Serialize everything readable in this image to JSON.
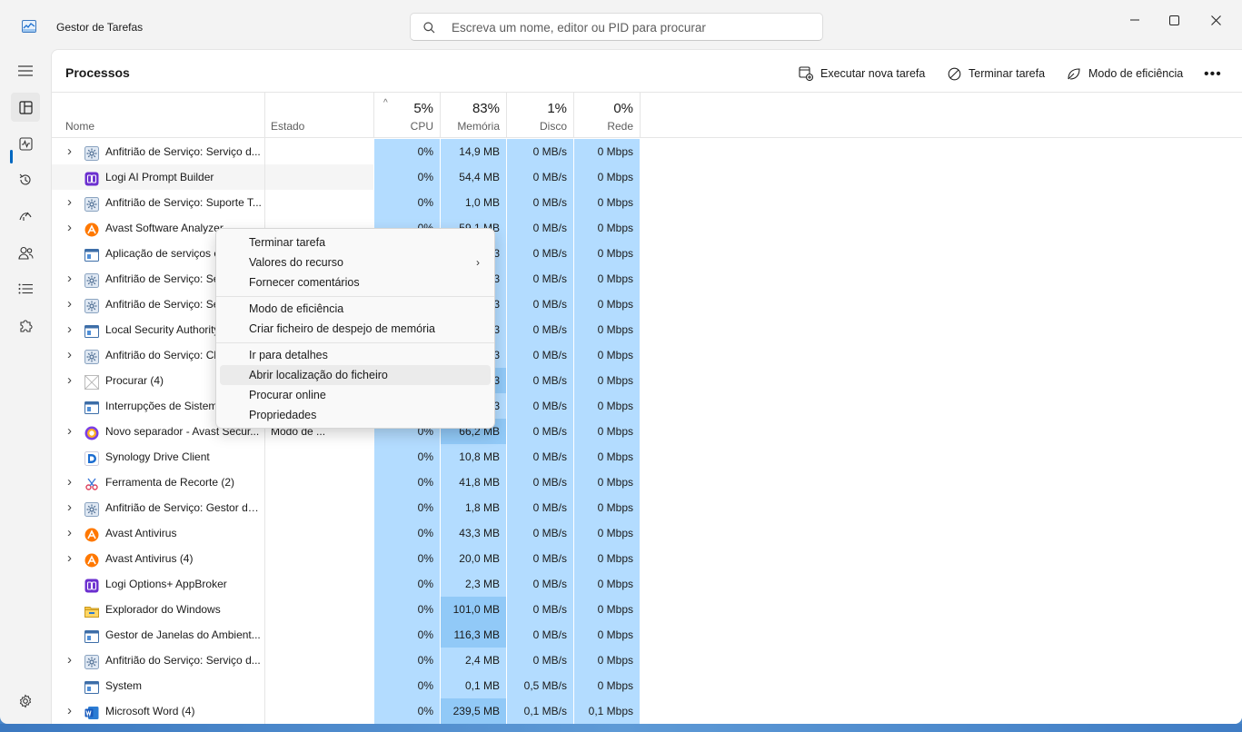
{
  "window": {
    "title": "Gestor de Tarefas"
  },
  "search": {
    "placeholder": "Escreva um nome, editor ou PID para procurar"
  },
  "header": {
    "title": "Processos",
    "run_task": "Executar nova tarefa",
    "end_task": "Terminar tarefa",
    "efficiency": "Modo de eficiência",
    "more": "•••"
  },
  "columns": {
    "name": "Nome",
    "status": "Estado",
    "cpu": {
      "pct": "5%",
      "label": "CPU"
    },
    "memory": {
      "pct": "83%",
      "label": "Memória"
    },
    "disk": {
      "pct": "1%",
      "label": "Disco"
    },
    "network": {
      "pct": "0%",
      "label": "Rede"
    }
  },
  "processes": [
    {
      "expand": true,
      "icon": "gear-icon",
      "name": "Anfitrião de Serviço: Serviço d...",
      "status": "",
      "cpu": "0%",
      "mem": "14,9 MB",
      "disk": "0 MB/s",
      "net": "0 Mbps"
    },
    {
      "expand": false,
      "icon": "logi-icon",
      "name": "Logi AI Prompt Builder",
      "status": "",
      "cpu": "0%",
      "mem": "54,4 MB",
      "disk": "0 MB/s",
      "net": "0 Mbps"
    },
    {
      "expand": true,
      "icon": "gear-icon",
      "name": "Anfitrião de Serviço: Suporte T...",
      "status": "",
      "cpu": "0%",
      "mem": "1,0 MB",
      "disk": "0 MB/s",
      "net": "0 Mbps"
    },
    {
      "expand": true,
      "icon": "avast-icon",
      "name": "Avast Software Analyzer",
      "status": "",
      "cpu": "0%",
      "mem": "59,1 MB",
      "disk": "0 MB/s",
      "net": "0 Mbps"
    },
    {
      "expand": false,
      "icon": "window-icon",
      "name": "Aplicação de serviços e",
      "status": "",
      "cpu": "0%",
      "mem": "3",
      "disk": "0 MB/s",
      "net": "0 Mbps"
    },
    {
      "expand": true,
      "icon": "gear-icon",
      "name": "Anfitrião de Serviço: Se",
      "status": "",
      "cpu": "0%",
      "mem": "3",
      "disk": "0 MB/s",
      "net": "0 Mbps"
    },
    {
      "expand": true,
      "icon": "gear-icon",
      "name": "Anfitrião de Serviço: Se",
      "status": "",
      "cpu": "0%",
      "mem": "3",
      "disk": "0 MB/s",
      "net": "0 Mbps"
    },
    {
      "expand": true,
      "icon": "window-icon",
      "name": "Local Security Authority",
      "status": "",
      "cpu": "0%",
      "mem": "3",
      "disk": "0 MB/s",
      "net": "0 Mbps"
    },
    {
      "expand": true,
      "icon": "gear-icon",
      "name": "Anfitrião do Serviço: Ch",
      "status": "",
      "cpu": "0%",
      "mem": "3",
      "disk": "0 MB/s",
      "net": "0 Mbps"
    },
    {
      "expand": true,
      "icon": "search-app-icon",
      "name": "Procurar (4)",
      "status": "",
      "cpu": "0%",
      "mem": "3",
      "disk": "0 MB/s",
      "net": "0 Mbps",
      "hot": true
    },
    {
      "expand": false,
      "icon": "window-icon",
      "name": "Interrupções de Sistema",
      "status": "",
      "cpu": "0%",
      "mem": "3",
      "disk": "0 MB/s",
      "net": "0 Mbps"
    },
    {
      "expand": true,
      "icon": "browser-icon",
      "name": "Novo separador - Avast Secur...",
      "status": "Modo de ...",
      "cpu": "0%",
      "mem": "66,2 MB",
      "disk": "0 MB/s",
      "net": "0 Mbps",
      "hot": true
    },
    {
      "expand": false,
      "icon": "synology-icon",
      "name": "Synology Drive Client",
      "status": "",
      "cpu": "0%",
      "mem": "10,8 MB",
      "disk": "0 MB/s",
      "net": "0 Mbps"
    },
    {
      "expand": true,
      "icon": "snip-icon",
      "name": "Ferramenta de Recorte (2)",
      "status": "",
      "cpu": "0%",
      "mem": "41,8 MB",
      "disk": "0 MB/s",
      "net": "0 Mbps"
    },
    {
      "expand": true,
      "icon": "gear-icon",
      "name": "Anfitrião de Serviço: Gestor de...",
      "status": "",
      "cpu": "0%",
      "mem": "1,8 MB",
      "disk": "0 MB/s",
      "net": "0 Mbps"
    },
    {
      "expand": true,
      "icon": "avast-icon",
      "name": "Avast Antivirus",
      "status": "",
      "cpu": "0%",
      "mem": "43,3 MB",
      "disk": "0 MB/s",
      "net": "0 Mbps"
    },
    {
      "expand": true,
      "icon": "avast-icon",
      "name": "Avast Antivirus (4)",
      "status": "",
      "cpu": "0%",
      "mem": "20,0 MB",
      "disk": "0 MB/s",
      "net": "0 Mbps"
    },
    {
      "expand": false,
      "icon": "logi-icon",
      "name": "Logi Options+ AppBroker",
      "status": "",
      "cpu": "0%",
      "mem": "2,3 MB",
      "disk": "0 MB/s",
      "net": "0 Mbps"
    },
    {
      "expand": false,
      "icon": "folder-icon",
      "name": "Explorador do Windows",
      "status": "",
      "cpu": "0%",
      "mem": "101,0 MB",
      "disk": "0 MB/s",
      "net": "0 Mbps",
      "hot": true
    },
    {
      "expand": false,
      "icon": "window-icon",
      "name": "Gestor de Janelas do Ambient...",
      "status": "",
      "cpu": "0%",
      "mem": "116,3 MB",
      "disk": "0 MB/s",
      "net": "0 Mbps",
      "hot": true
    },
    {
      "expand": true,
      "icon": "gear-icon",
      "name": "Anfitrião do Serviço: Serviço d...",
      "status": "",
      "cpu": "0%",
      "mem": "2,4 MB",
      "disk": "0 MB/s",
      "net": "0 Mbps"
    },
    {
      "expand": false,
      "icon": "window-icon",
      "name": "System",
      "status": "",
      "cpu": "0%",
      "mem": "0,1 MB",
      "disk": "0,5 MB/s",
      "net": "0 Mbps"
    },
    {
      "expand": true,
      "icon": "word-icon",
      "name": "Microsoft Word (4)",
      "status": "",
      "cpu": "0%",
      "mem": "239,5 MB",
      "disk": "0,1 MB/s",
      "net": "0,1 Mbps",
      "hot": true
    }
  ],
  "context_menu": {
    "items": [
      "Terminar tarefa",
      "Valores do recurso",
      "Fornecer comentários",
      "Modo de eficiência",
      "Criar ficheiro de despejo de memória",
      "Ir para detalhes",
      "Abrir localização do ficheiro",
      "Procurar online",
      "Propriedades"
    ]
  },
  "colors": {
    "accent": "#0067c0",
    "heat_light": "#b3dcff",
    "heat_dark": "#91c9f7"
  }
}
